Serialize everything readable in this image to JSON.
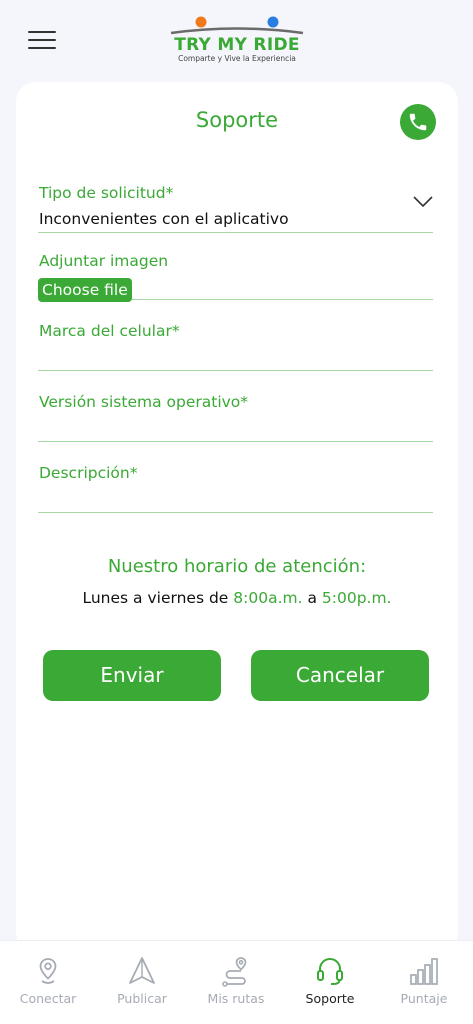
{
  "logo": {
    "title": "TRY MY RIDE",
    "subtitle": "Comparte y Vive la Experiencia",
    "dot_left_color": "#f07a1a",
    "dot_right_color": "#2a7de1"
  },
  "page": {
    "title": "Soporte",
    "phone_icon": "phone-icon"
  },
  "form": {
    "tipo_label": "Tipo de solicitud*",
    "tipo_value": "Inconvenientes con el aplicativo",
    "adjuntar_label": "Adjuntar imagen",
    "choose_file_label": "Choose file",
    "marca_label": "Marca del celular*",
    "version_label": "Versión sistema operativo*",
    "descripcion_label": "Descripción*"
  },
  "hours": {
    "title": "Nuestro horario de atención:",
    "days": "Lunes a viernes de ",
    "from": "8:00a.m.",
    "connector": " a ",
    "to": "5:00p.m."
  },
  "actions": {
    "send_label": "Enviar",
    "cancel_label": "Cancelar"
  },
  "nav": {
    "items": [
      {
        "label": "Conectar",
        "icon": "location-pin-icon"
      },
      {
        "label": "Publicar",
        "icon": "navigation-arrow-icon"
      },
      {
        "label": "Mis rutas",
        "icon": "route-icon"
      },
      {
        "label": "Soporte",
        "icon": "headset-icon"
      },
      {
        "label": "Puntaje",
        "icon": "bar-chart-icon"
      }
    ],
    "active_index": 3
  },
  "colors": {
    "brand_green": "#3aa935",
    "inactive_gray": "#a6abb4",
    "background": "#f5f6fb"
  }
}
